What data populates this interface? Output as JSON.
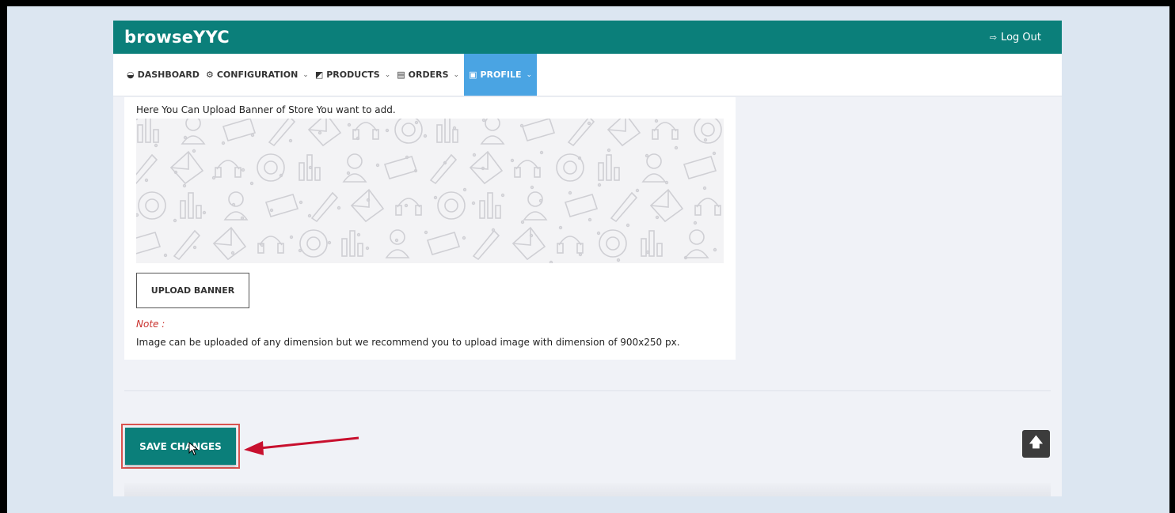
{
  "app": {
    "brand": "browseYYC",
    "logout_label": "Log Out",
    "logout_icon": "sign-out-icon"
  },
  "nav": {
    "items": [
      {
        "label": "DASHBOARD",
        "icon": "dashboard-icon",
        "has_dropdown": false,
        "active": false
      },
      {
        "label": "CONFIGURATION",
        "icon": "gear-icon",
        "has_dropdown": true,
        "active": false
      },
      {
        "label": "PRODUCTS",
        "icon": "tag-icon",
        "has_dropdown": true,
        "active": false
      },
      {
        "label": "ORDERS",
        "icon": "clipboard-icon",
        "has_dropdown": true,
        "active": false
      },
      {
        "label": "PROFILE",
        "icon": "id-card-icon",
        "has_dropdown": true,
        "active": true
      }
    ]
  },
  "banner_section": {
    "help_text": "Here You Can Upload Banner of Store You want to add.",
    "upload_button": "UPLOAD BANNER",
    "note_label": "Note :",
    "note_text": "Image can be uploaded of any dimension but we recommend you to upload image with dimension of 900x250 px."
  },
  "actions": {
    "save_label": "SAVE CHANGES",
    "scroll_top_icon": "arrow-up-icon"
  },
  "colors": {
    "brand_teal": "#0b7f7a",
    "nav_active": "#4aa4e3",
    "note_red": "#c9302c",
    "highlight_red": "#d9534f",
    "annotation_arrow": "#c8102e"
  }
}
